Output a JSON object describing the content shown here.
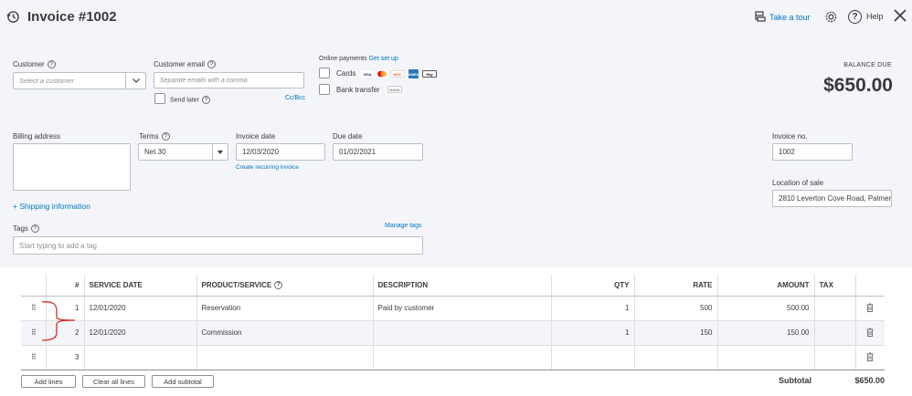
{
  "header": {
    "title": "Invoice #1002",
    "take_tour": "Take a tour",
    "help": "Help"
  },
  "customer": {
    "label": "Customer",
    "placeholder": "Select a customer"
  },
  "email": {
    "label": "Customer email",
    "placeholder": "Separate emails with a comma",
    "send_later": "Send later",
    "cc_bcc": "Cc/Bcc"
  },
  "online_payments": {
    "label": "Online payments",
    "get_setup": "Get set up",
    "cards": "Cards",
    "bank_transfer": "Bank transfer",
    "card_logos": [
      "VISA",
      "MC",
      "DISC",
      "AMEX",
      "Pay"
    ],
    "bank_logo": "BANK"
  },
  "balance": {
    "label": "BALANCE DUE",
    "amount": "$650.00"
  },
  "billing": {
    "label": "Billing address",
    "value": ""
  },
  "terms": {
    "label": "Terms",
    "value": "Net 30"
  },
  "invoice_date": {
    "label": "Invoice date",
    "value": "12/03/2020",
    "recurring": "Create recurring invoice"
  },
  "due_date": {
    "label": "Due date",
    "value": "01/02/2021"
  },
  "invoice_no": {
    "label": "Invoice no.",
    "value": "1002"
  },
  "location": {
    "label": "Location of sale",
    "value": "2810 Leverton Cove Road, Palmer"
  },
  "shipping": "+ Shipping information",
  "tags": {
    "label": "Tags",
    "manage": "Manage tags",
    "placeholder": "Start typing to add a tag"
  },
  "table": {
    "headers": [
      "#",
      "SERVICE DATE",
      "PRODUCT/SERVICE",
      "DESCRIPTION",
      "QTY",
      "RATE",
      "AMOUNT",
      "TAX"
    ],
    "rows": [
      {
        "num": "1",
        "date": "12/01/2020",
        "product": "Reservation",
        "description": "Paid by customer",
        "qty": "1",
        "rate": "500",
        "amount": "500.00"
      },
      {
        "num": "2",
        "date": "12/01/2020",
        "product": "Commission",
        "description": "",
        "qty": "1",
        "rate": "150",
        "amount": "150.00"
      },
      {
        "num": "3",
        "date": "",
        "product": "",
        "description": "",
        "qty": "",
        "rate": "",
        "amount": ""
      }
    ]
  },
  "footer": {
    "add_lines": "Add lines",
    "clear_lines": "Clear all lines",
    "add_subtotal": "Add subtotal",
    "subtotal_label": "Subtotal",
    "subtotal_value": "$650.00"
  },
  "colors": {
    "accent": "#0077c5",
    "bracket": "#d52b1e"
  }
}
